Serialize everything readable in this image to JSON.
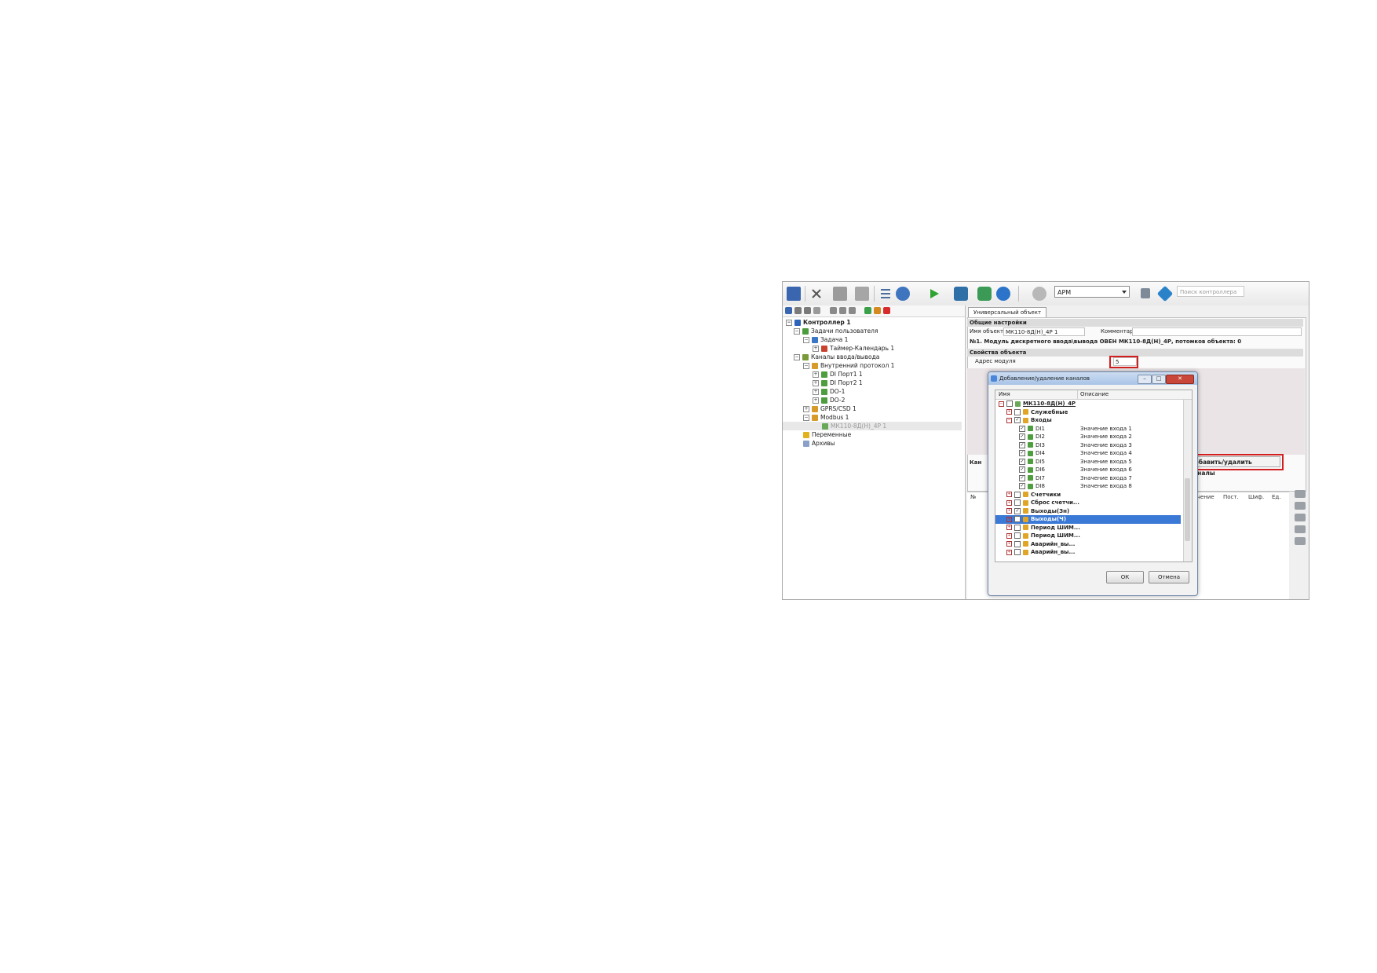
{
  "toolbar": {
    "combo_value": "АРМ",
    "search_placeholder": "Поиск контроллера"
  },
  "tree": [
    {
      "label": "Контроллер 1",
      "bold": true
    },
    {
      "label": "Задачи пользователя"
    },
    {
      "label": "Задача 1"
    },
    {
      "label": "Таймер-Календарь 1"
    },
    {
      "label": "Каналы ввода/вывода"
    },
    {
      "label": "Внутренний протокол 1"
    },
    {
      "label": "DI Порт1 1"
    },
    {
      "label": "DI Порт2 1"
    },
    {
      "label": "DO-1"
    },
    {
      "label": "DO-2"
    },
    {
      "label": "GPRS/CSD 1"
    },
    {
      "label": "Modbus 1"
    },
    {
      "label": "МК110-8Д(Н)_4Р 1"
    },
    {
      "label": "Переменные"
    },
    {
      "label": "Архивы"
    }
  ],
  "tab_label": "Универсальный объект",
  "general": {
    "section_title": "Общие настройки",
    "name_label": "Имя объекта",
    "name_value": "МК110-8Д(Н)_4Р 1",
    "comment_label": "Комментарий",
    "info_line": "№1. Модуль дискретного ввода\\вывода ОВЕН МК110-8Д(Н)_4Р, потомков объекта: 0"
  },
  "properties": {
    "section_title": "Свойства объекта",
    "address_label": "Адрес модуля",
    "address_value": "5"
  },
  "channels_cut_label": "Кан",
  "add_button_label": "Добавить/удалить каналы",
  "grid": {
    "first_col": "№",
    "cols": [
      "начение",
      "Пост.",
      "Шиф.",
      "Ед."
    ]
  },
  "dialog": {
    "title": "Добавление/удаление каналов",
    "col_name": "Имя",
    "col_desc": "Описание",
    "rows": [
      {
        "name": "МК110-8Д(Н)_4Р",
        "desc": "",
        "bold": true,
        "checked": false
      },
      {
        "name": "Служебные",
        "desc": "",
        "bold": true,
        "checked": false
      },
      {
        "name": "Входы",
        "desc": "",
        "bold": true,
        "checked": true
      },
      {
        "name": "DI1",
        "desc": "Значение входа 1",
        "checked": true
      },
      {
        "name": "DI2",
        "desc": "Значение входа 2",
        "checked": true
      },
      {
        "name": "DI3",
        "desc": "Значение входа 3",
        "checked": true
      },
      {
        "name": "DI4",
        "desc": "Значение входа 4",
        "checked": true
      },
      {
        "name": "DI5",
        "desc": "Значение входа 5",
        "checked": true
      },
      {
        "name": "DI6",
        "desc": "Значение входа 6",
        "checked": true
      },
      {
        "name": "DI7",
        "desc": "Значение входа 7",
        "checked": true
      },
      {
        "name": "DI8",
        "desc": "Значение входа 8",
        "checked": true
      },
      {
        "name": "Счетчики",
        "desc": "",
        "bold": true,
        "checked": false
      },
      {
        "name": "Сброс счетчи...",
        "desc": "",
        "bold": true,
        "checked": false
      },
      {
        "name": "Выходы(Зн)",
        "desc": "",
        "bold": true,
        "checked": true
      },
      {
        "name": "Выходы(Ч)",
        "desc": "",
        "bold": true,
        "checked": true,
        "selected": true
      },
      {
        "name": "Период ШИМ...",
        "desc": "",
        "bold": true,
        "checked": false
      },
      {
        "name": "Период ШИМ...",
        "desc": "",
        "bold": true,
        "checked": false
      },
      {
        "name": "Аварийн_вы...",
        "desc": "",
        "bold": true,
        "checked": false
      },
      {
        "name": "Аварийн_вы...",
        "desc": "",
        "bold": true,
        "checked": false
      }
    ],
    "ok_label": "ОК",
    "cancel_label": "Отмена"
  },
  "colors": {
    "highlight": "#d21f1f",
    "selection": "#3a79d6"
  }
}
